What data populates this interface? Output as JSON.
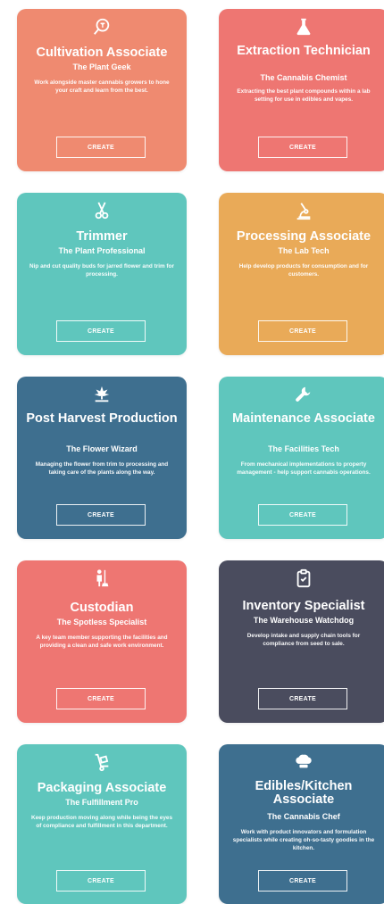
{
  "cards": [
    {
      "title": "Cultivation Associate",
      "subtitle": "The Plant Geek",
      "description": "Work alongside master cannabis growers to hone your craft and learn from the best.",
      "button": "CREATE",
      "color": "#ef8a70",
      "icon": "magnifier-plant-icon"
    },
    {
      "title": "Extraction Technician",
      "subtitle": "The Cannabis Chemist",
      "description": "Extracting the best plant compounds within a lab setting for use in edibles and vapes.",
      "button": "CREATE",
      "color": "#ee7672",
      "icon": "flask-icon"
    },
    {
      "title": "Trimmer",
      "subtitle": "The Plant Professional",
      "description": "Nip and cut quality buds for jarred flower and trim for processing.",
      "button": "CREATE",
      "color": "#5fc6bd",
      "icon": "scissors-icon"
    },
    {
      "title": "Processing Associate",
      "subtitle": "The Lab Tech",
      "description": "Help develop products for consumption and for customers.",
      "button": "CREATE",
      "color": "#e9aa58",
      "icon": "microscope-icon"
    },
    {
      "title": "Post Harvest Production",
      "subtitle": "The Flower Wizard",
      "description": "Managing the flower from trim to processing and taking care of the plants along the way.",
      "button": "CREATE",
      "color": "#3e6f8f",
      "icon": "plant-icon"
    },
    {
      "title": "Maintenance Associate",
      "subtitle": "The Facilities Tech",
      "description": "From mechanical implementations to property management - help support cannabis operations.",
      "button": "CREATE",
      "color": "#5fc6bd",
      "icon": "wrench-icon"
    },
    {
      "title": "Custodian",
      "subtitle": "The Spotless Specialist",
      "description": "A key team member supporting the facilities and providing a clean and safe work environment.",
      "button": "CREATE",
      "color": "#ee7672",
      "icon": "custodian-icon"
    },
    {
      "title": "Inventory Specialist",
      "subtitle": "The Warehouse Watchdog",
      "description": "Develop intake and supply chain tools for compliance from seed to sale.",
      "button": "CREATE",
      "color": "#4a4c5e",
      "icon": "clipboard-icon"
    },
    {
      "title": "Packaging Associate",
      "subtitle": "The Fulfillment Pro",
      "description": "Keep production moving along while being the eyes of compliance and fulfillment in this department.",
      "button": "CREATE",
      "color": "#5fc6bd",
      "icon": "hand-truck-icon"
    },
    {
      "title": "Edibles/Kitchen Associate",
      "subtitle": "The Cannabis Chef",
      "description": "Work with product innovators and formulation specialists while creating oh-so-tasty goodies in the kitchen.",
      "button": "CREATE",
      "color": "#3e6f8f",
      "icon": "chef-hat-icon"
    }
  ]
}
